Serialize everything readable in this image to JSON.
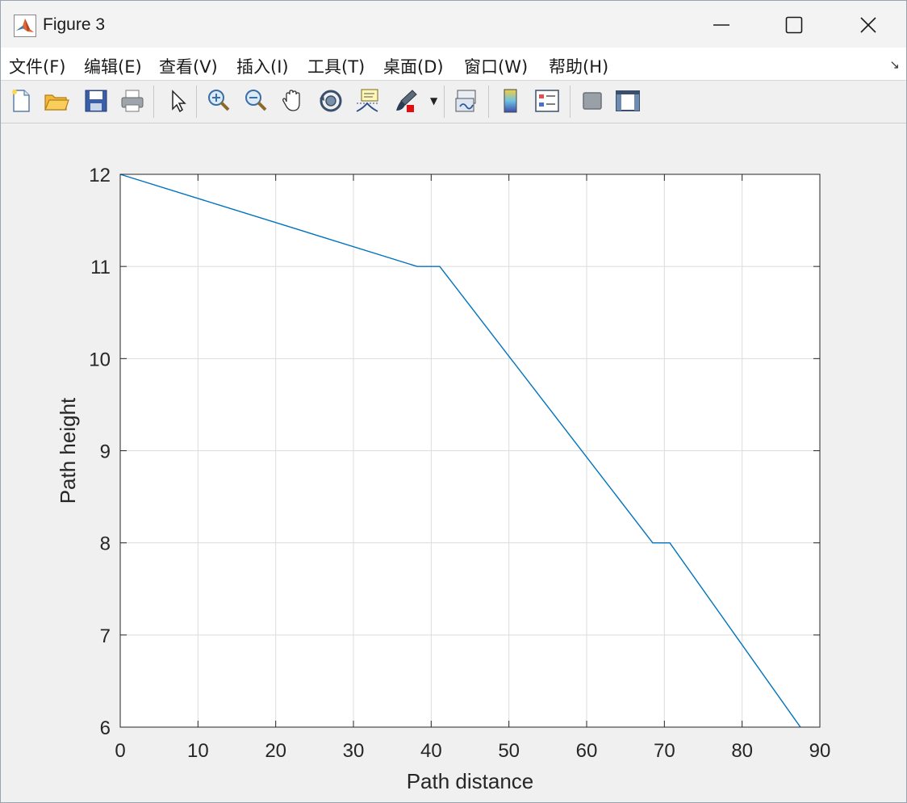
{
  "window": {
    "title": "Figure 3",
    "controls": {
      "minimize": "minimize",
      "maximize": "maximize",
      "close": "close"
    }
  },
  "menu": {
    "items": [
      {
        "label": "文件(F)"
      },
      {
        "label": "编辑(E)"
      },
      {
        "label": "查看(V)"
      },
      {
        "label": "插入(I)"
      },
      {
        "label": "工具(T)"
      },
      {
        "label": "桌面(D)"
      },
      {
        "label": "窗口(W)"
      },
      {
        "label": "帮助(H)"
      }
    ],
    "overflow_icon": "expand-arrow-icon"
  },
  "toolbar": {
    "buttons": [
      "new-figure-icon",
      "open-folder-icon",
      "save-icon",
      "print-icon",
      "edit-pointer-icon",
      "zoom-in-icon",
      "zoom-out-icon",
      "pan-hand-icon",
      "rotate-3d-icon",
      "data-cursor-icon",
      "brush-icon",
      "link-plot-icon",
      "colorbar-icon",
      "legend-icon",
      "hide-plot-tools-icon",
      "show-plot-tools-icon"
    ]
  },
  "colors": {
    "line": "#0072bd",
    "grid": "#dcdcdc",
    "axes": "#262626",
    "plot_bg": "#ffffff",
    "figure_bg": "#f0f0f0"
  },
  "chart_data": {
    "type": "line",
    "title": "",
    "xlabel": "Path distance",
    "ylabel": "Path height",
    "xlim": [
      0,
      90
    ],
    "ylim": [
      6,
      12
    ],
    "xticks": [
      0,
      10,
      20,
      30,
      40,
      50,
      60,
      70,
      80,
      90
    ],
    "yticks": [
      6,
      7,
      8,
      9,
      10,
      11,
      12
    ],
    "grid": true,
    "series": [
      {
        "x": [
          0,
          38.2,
          41.1,
          68.5,
          70.7,
          87.5
        ],
        "y": [
          12,
          11,
          11,
          8,
          8,
          6
        ]
      }
    ]
  }
}
